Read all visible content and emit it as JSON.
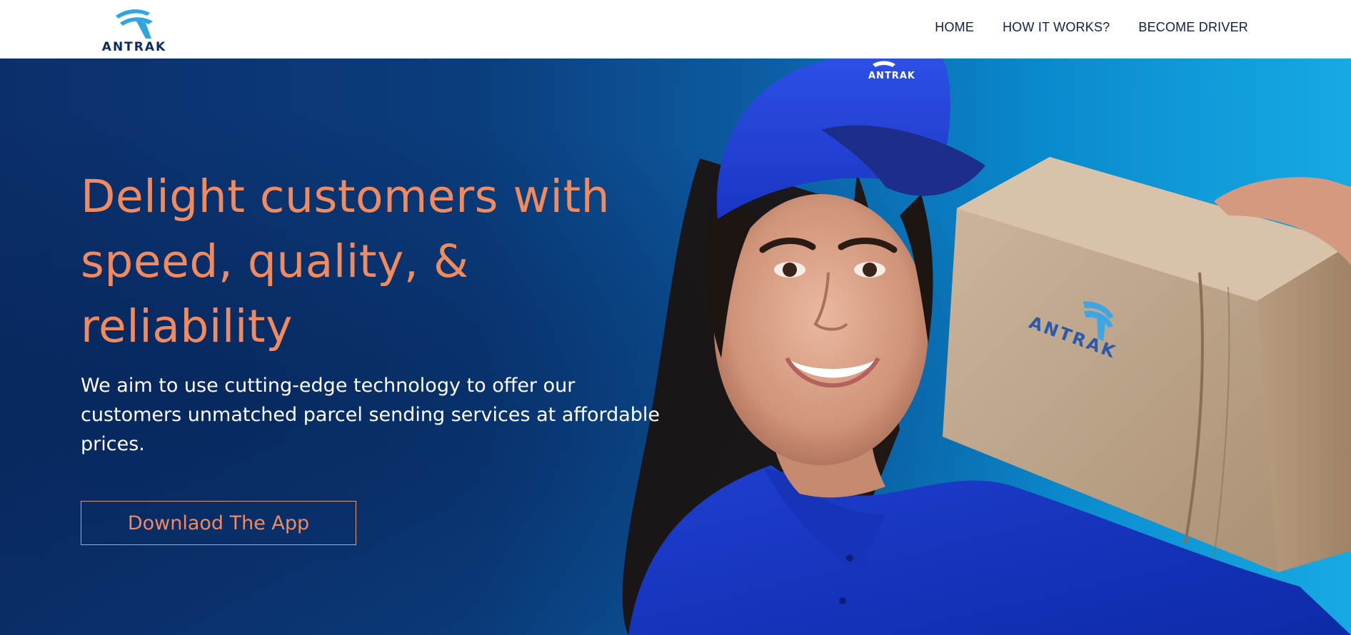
{
  "header": {
    "logo_text": "ANTRAK",
    "nav": [
      {
        "label": "HOME"
      },
      {
        "label": "HOW IT WORKS?"
      },
      {
        "label": "BECOME DRIVER"
      }
    ]
  },
  "hero": {
    "headline": "Delight customers with speed, quality, & reliability",
    "subtext": "We aim to use cutting-edge technology to offer our customers unmatched parcel sending services at affordable prices.",
    "cta_label": "Downlaod The App",
    "photo": {
      "cap_logo_text": "ANTRAK",
      "box_logo_text": "ANTRAK"
    }
  },
  "colors": {
    "accent": "#f18a5f",
    "navy": "#0b2f6b",
    "sky": "#17a9e2",
    "nav_text": "#0d1f4a"
  },
  "icons": {
    "logo": "antrak-swoosh-icon"
  }
}
